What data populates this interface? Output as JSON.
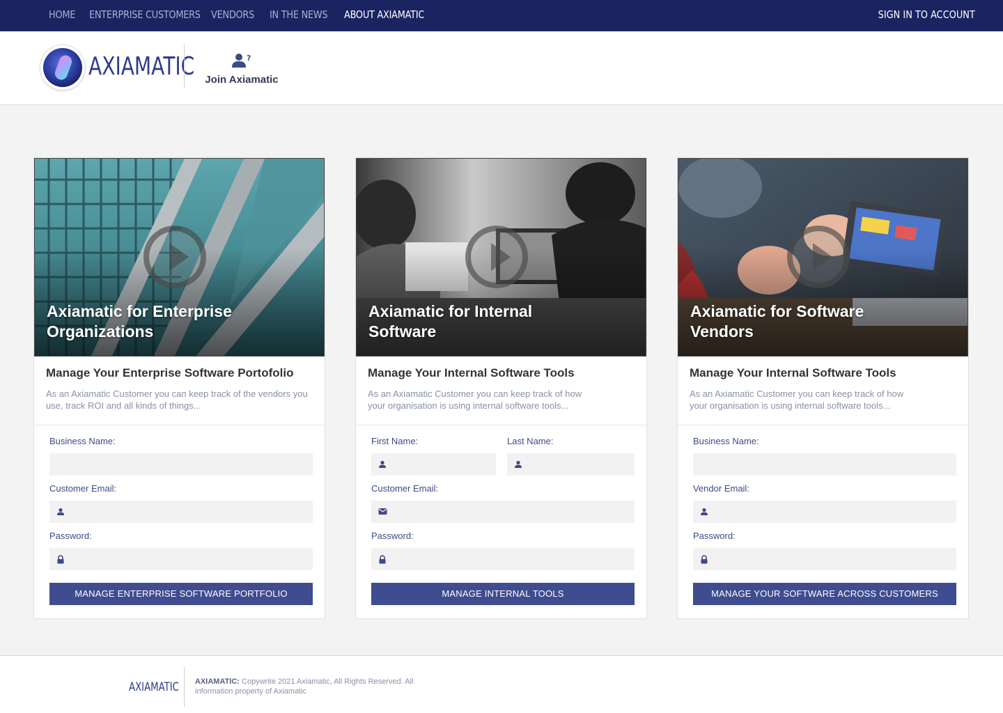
{
  "nav": {
    "items": [
      {
        "label": "HOME"
      },
      {
        "label": "ENTERPRISE CUSTOMERS"
      },
      {
        "label": "VENDORS"
      },
      {
        "label": "IN THE NEWS"
      },
      {
        "label": "ABOUT AXIAMATIC"
      }
    ],
    "active": "ABOUT AXIAMATIC",
    "signin_label": "SIGN IN TO ACCOUNT"
  },
  "header": {
    "logo_text": "AXIAMATIC",
    "join_label": "Join Axiamatic",
    "join_icon": "user-question-icon"
  },
  "cards": [
    {
      "hero_title": "Axiamatic for Enterprise Organizations",
      "subtitle": "Manage Your Enterprise Software Portofolio",
      "description": "As an Axiamatic Customer you can keep track of the vendors you use, track ROI and all kinds of things...",
      "fields": [
        {
          "label": "Business Name:",
          "icon": ""
        },
        {
          "label": "Customer Email:",
          "icon": "person-icon"
        },
        {
          "label": "Password:",
          "icon": "lock-icon"
        }
      ],
      "button_label": "MANAGE ENTERPRISE SOFTWARE PORTFOLIO"
    },
    {
      "hero_title": "Axiamatic for Internal Software",
      "subtitle": "Manage Your Internal Software Tools",
      "description": "As an Axiamatic Customer you can keep track of how your organisation is using internal software tools...",
      "fields": [
        {
          "label": "First Name:",
          "icon": "person-icon"
        },
        {
          "label": "Last Name:",
          "icon": "person-icon"
        },
        {
          "label": "Customer Email:",
          "icon": "mail-icon"
        },
        {
          "label": "Password:",
          "icon": "lock-icon"
        }
      ],
      "button_label": "MANAGE INTERNAL TOOLS"
    },
    {
      "hero_title": "Axiamatic for Software Vendors",
      "subtitle": "Manage Your Internal Software Tools",
      "description": "As an Axiamatic Customer you can keep track of how your organisation is using internal software tools...",
      "fields": [
        {
          "label": "Business Name:",
          "icon": ""
        },
        {
          "label": "Vendor Email:",
          "icon": "person-icon"
        },
        {
          "label": "Password:",
          "icon": "lock-icon"
        }
      ],
      "button_label": "MANAGE YOUR SOFTWARE ACROSS CUSTOMERS"
    }
  ],
  "footer": {
    "logo_text": "AXIAMATIC",
    "brand": "AXIAMATIC:",
    "copyright": "Copywrite 2021 Axiamatic, All Rights Reserved. All information property of Axiamatic"
  },
  "colors": {
    "nav_bg": "#1b2361",
    "brand": "#2f3a8f",
    "button": "#3f4c8f",
    "label": "#3d4a86",
    "input_bg": "#f2f2f2"
  }
}
